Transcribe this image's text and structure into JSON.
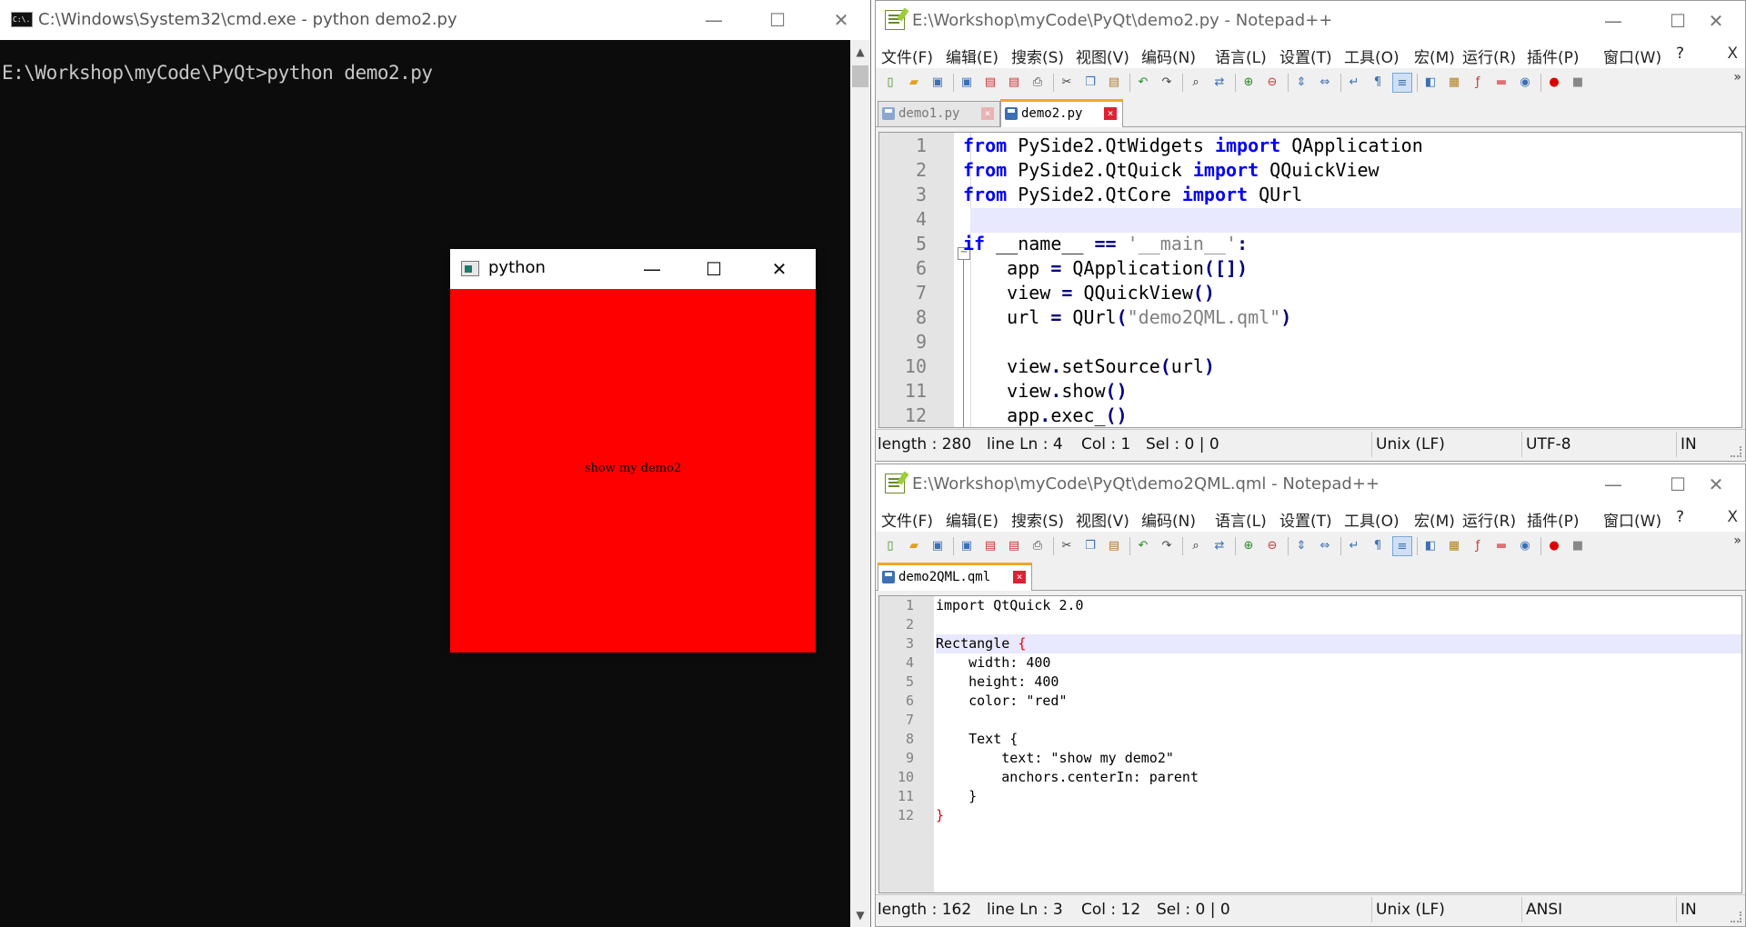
{
  "cmd": {
    "title": "C:\\Windows\\System32\\cmd.exe - python  demo2.py",
    "icon_text": "C:\\.",
    "prompt": "E:\\Workshop\\myCode\\PyQt>python demo2.py",
    "minimize": "—",
    "maximize": "☐",
    "close": "✕"
  },
  "qml_window": {
    "title": "python",
    "rect_color": "#ff0000",
    "text": "show my demo2",
    "minimize": "—",
    "maximize": "☐",
    "close": "✕"
  },
  "npp_top": {
    "title": "E:\\Workshop\\myCode\\PyQt\\demo2.py - Notepad++",
    "menu": [
      "文件(F)",
      "编辑(E)",
      "搜索(S)",
      "视图(V)",
      "编码(N)",
      "语言(L)",
      "设置(T)",
      "工具(O)",
      "宏(M)",
      "运行(R)",
      "插件(P)",
      "窗口(W)",
      "?"
    ],
    "menu_close": "X",
    "tabs": [
      {
        "label": "demo1.py",
        "active": false
      },
      {
        "label": "demo2.py",
        "active": true
      }
    ],
    "lines": [
      {
        "n": "1"
      },
      {
        "n": "2"
      },
      {
        "n": "3"
      },
      {
        "n": "4"
      },
      {
        "n": "5"
      },
      {
        "n": "6"
      },
      {
        "n": "7"
      },
      {
        "n": "8"
      },
      {
        "n": "9"
      },
      {
        "n": "10"
      },
      {
        "n": "11"
      },
      {
        "n": "12"
      }
    ],
    "code": {
      "l1": [
        "from",
        " PySide2.QtWidgets ",
        "import",
        " QApplication"
      ],
      "l2": [
        "from",
        " PySide2.QtQuick ",
        "import",
        " QQuickView"
      ],
      "l3": [
        "from",
        " PySide2.QtCore ",
        "import",
        " QUrl"
      ],
      "l5": [
        "if",
        " __name__ ",
        "==",
        " ",
        "'__main__'",
        ":"
      ],
      "l6": [
        "    app ",
        "=",
        " QApplication",
        "([])"
      ],
      "l7": [
        "    view ",
        "=",
        " QQuickView",
        "()"
      ],
      "l8": [
        "    url ",
        "=",
        " QUrl",
        "(",
        "\"demo2QML.qml\"",
        ")"
      ],
      "l10": [
        "    view",
        ".",
        "setSource",
        "(",
        "url",
        ")"
      ],
      "l11": [
        "    view",
        ".",
        "show",
        "()"
      ],
      "l12": [
        "    app",
        ".",
        "exec_",
        "()"
      ]
    },
    "status": {
      "length": "length : 280",
      "line": "line Ln : 4",
      "col": "Col : 1",
      "sel": "Sel : 0 | 0",
      "eol": "Unix (LF)",
      "encoding": "UTF-8",
      "mode": "IN"
    }
  },
  "npp_bottom": {
    "title": "E:\\Workshop\\myCode\\PyQt\\demo2QML.qml - Notepad++",
    "menu": [
      "文件(F)",
      "编辑(E)",
      "搜索(S)",
      "视图(V)",
      "编码(N)",
      "语言(L)",
      "设置(T)",
      "工具(O)",
      "宏(M)",
      "运行(R)",
      "插件(P)",
      "窗口(W)",
      "?"
    ],
    "menu_close": "X",
    "tabs": [
      {
        "label": "demo2QML.qml",
        "active": true
      }
    ],
    "lines": [
      {
        "n": "1",
        "text": "import QtQuick 2.0"
      },
      {
        "n": "2",
        "text": ""
      },
      {
        "n": "3",
        "text": "Rectangle "
      },
      {
        "n": "4",
        "text": "    width: 400"
      },
      {
        "n": "5",
        "text": "    height: 400"
      },
      {
        "n": "6",
        "text": "    color: \"red\""
      },
      {
        "n": "7",
        "text": ""
      },
      {
        "n": "8",
        "text": "    Text {"
      },
      {
        "n": "9",
        "text": "        text: \"show my demo2\""
      },
      {
        "n": "10",
        "text": "        anchors.centerIn: parent"
      },
      {
        "n": "11",
        "text": "    }"
      },
      {
        "n": "12",
        "text": ""
      }
    ],
    "brace_open": "{",
    "brace_close": "}",
    "status": {
      "length": "length : 162",
      "line": "line Ln : 3",
      "col": "Col : 12",
      "sel": "Sel : 0 | 0",
      "eol": "Unix (LF)",
      "encoding": "ANSI",
      "mode": "IN"
    }
  },
  "toolbar_icons": [
    "new-file-icon",
    "open-file-icon",
    "save-icon",
    "save-all-icon",
    "close-icon",
    "close-all-icon",
    "print-icon",
    "cut-icon",
    "copy-icon",
    "paste-icon",
    "undo-icon",
    "redo-icon",
    "find-icon",
    "replace-icon",
    "zoom-in-icon",
    "zoom-out-icon",
    "sync-vertical-icon",
    "sync-horizontal-icon",
    "word-wrap-icon",
    "show-all-chars-icon",
    "indent-guide-icon",
    "language-icon",
    "document-map-icon",
    "function-list-icon",
    "folder-workspace-icon",
    "monitoring-icon",
    "record-macro-icon",
    "stop-record-icon"
  ]
}
